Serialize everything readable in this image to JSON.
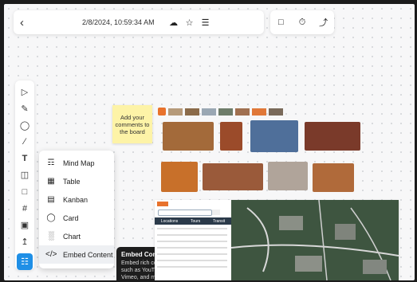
{
  "topbar": {
    "back_icon": "chevron-left-icon",
    "timestamp": "2/8/2024, 10:59:34 AM",
    "icons": [
      "cloud-icon",
      "star-icon",
      "menu-icon"
    ],
    "right_icons": [
      "present-icon",
      "timer-icon",
      "pointer-icon"
    ]
  },
  "toolbar": {
    "tools": [
      "select-icon",
      "pen-icon",
      "shapes-icon",
      "line-icon",
      "text-icon",
      "sticky-note-icon",
      "comment-icon",
      "frame-icon",
      "template-icon",
      "upload-icon",
      "more-apps-icon"
    ]
  },
  "menu": {
    "items": [
      {
        "label": "Mind Map",
        "icon": "mind-map-icon"
      },
      {
        "label": "Table",
        "icon": "table-icon"
      },
      {
        "label": "Kanban",
        "icon": "kanban-icon"
      },
      {
        "label": "Card",
        "icon": "card-icon"
      },
      {
        "label": "Chart",
        "icon": "chart-icon"
      },
      {
        "label": "Embed Content",
        "icon": "code-icon"
      }
    ]
  },
  "tooltip": {
    "title": "Embed Content",
    "body": "Embed rich content such as YouTube, Vimeo, and more."
  },
  "sticky": {
    "text": "Add your comments to the board"
  },
  "map_embed": {
    "tabs": [
      "Locations",
      "Tours",
      "Transit"
    ]
  },
  "colors": {
    "accent": "#1f8fe6",
    "sticky": "#fdf3a7",
    "tooltip_bg": "#1e1e1e"
  }
}
